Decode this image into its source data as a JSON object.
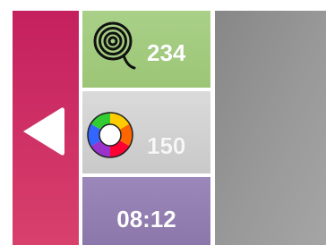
{
  "back_button": {
    "icon": "back-arrow-icon",
    "color": "#c4205e"
  },
  "stats": {
    "moves": {
      "icon": "spiral-icon",
      "value": "234",
      "color": "#a9d088"
    },
    "colors": {
      "icon": "color-wheel-icon",
      "value": "150",
      "color": "#d4d4d4"
    },
    "timer": {
      "value": "08:12",
      "color": "#9c87ba"
    }
  },
  "board": {
    "color": "#999999"
  }
}
